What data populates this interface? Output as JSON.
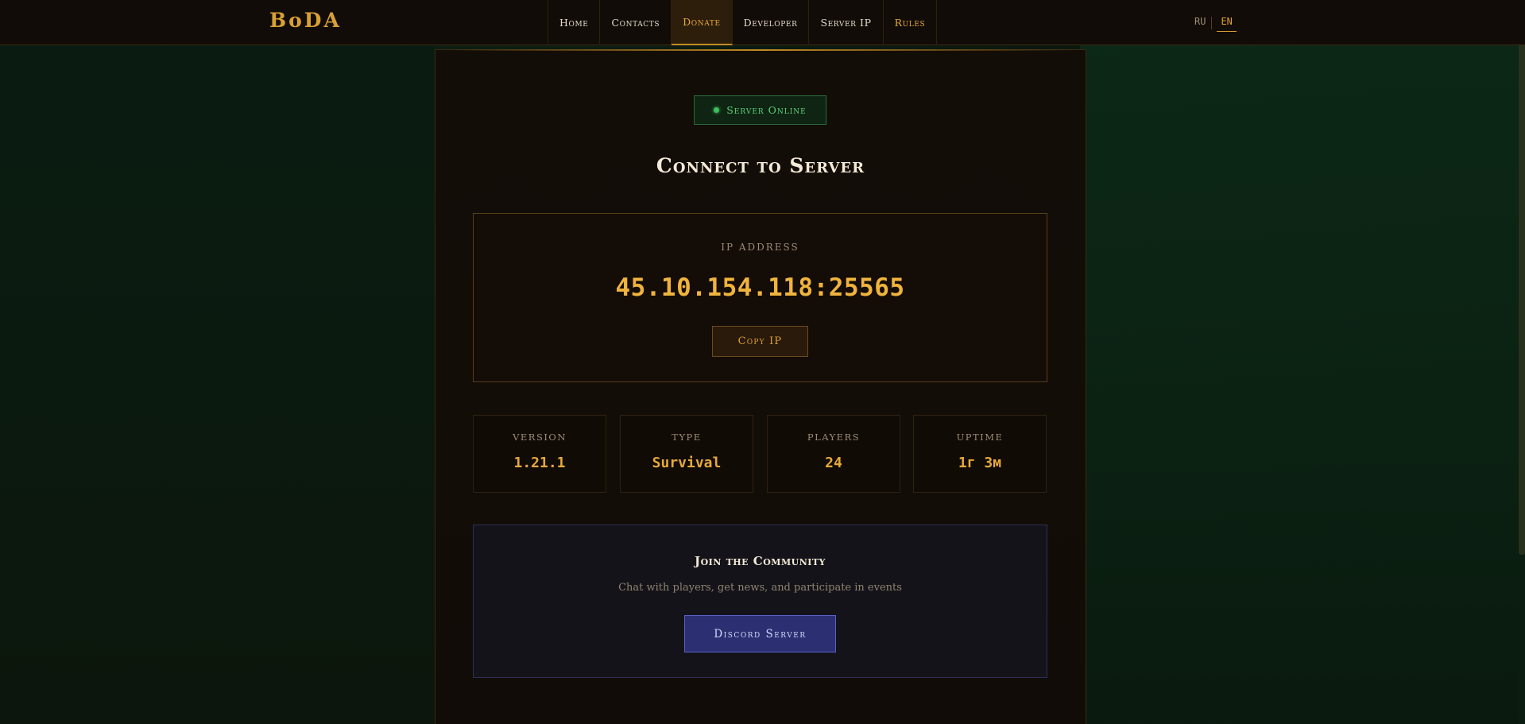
{
  "header": {
    "logo": "BoDA",
    "nav": [
      {
        "label": "Home"
      },
      {
        "label": "Contacts"
      },
      {
        "label": "Donate"
      },
      {
        "label": "Developer"
      },
      {
        "label": "Server IP"
      },
      {
        "label": "Rules"
      }
    ],
    "active_nav": "Donate",
    "languages": [
      {
        "label": "RU"
      },
      {
        "label": "EN"
      }
    ],
    "active_language": "EN"
  },
  "status": {
    "label": "Server Online",
    "color": "#3fbd5a"
  },
  "main": {
    "title": "Connect to Server",
    "ip": {
      "label": "IP ADDRESS",
      "value": "45.10.154.118:25565",
      "copy_label": "Copy IP"
    },
    "stats": [
      {
        "label": "VERSION",
        "value": "1.21.1"
      },
      {
        "label": "TYPE",
        "value": "Survival"
      },
      {
        "label": "PLAYERS",
        "value": "24"
      },
      {
        "label": "UPTIME",
        "value": "1г 3м"
      }
    ],
    "community": {
      "title": "Join the Community",
      "description": "Chat with players, get news, and participate in events",
      "button_label": "Discord Server"
    }
  },
  "colors": {
    "accent": "#d9a033",
    "online": "#3fbd5a",
    "discord": "#2c2f72"
  }
}
